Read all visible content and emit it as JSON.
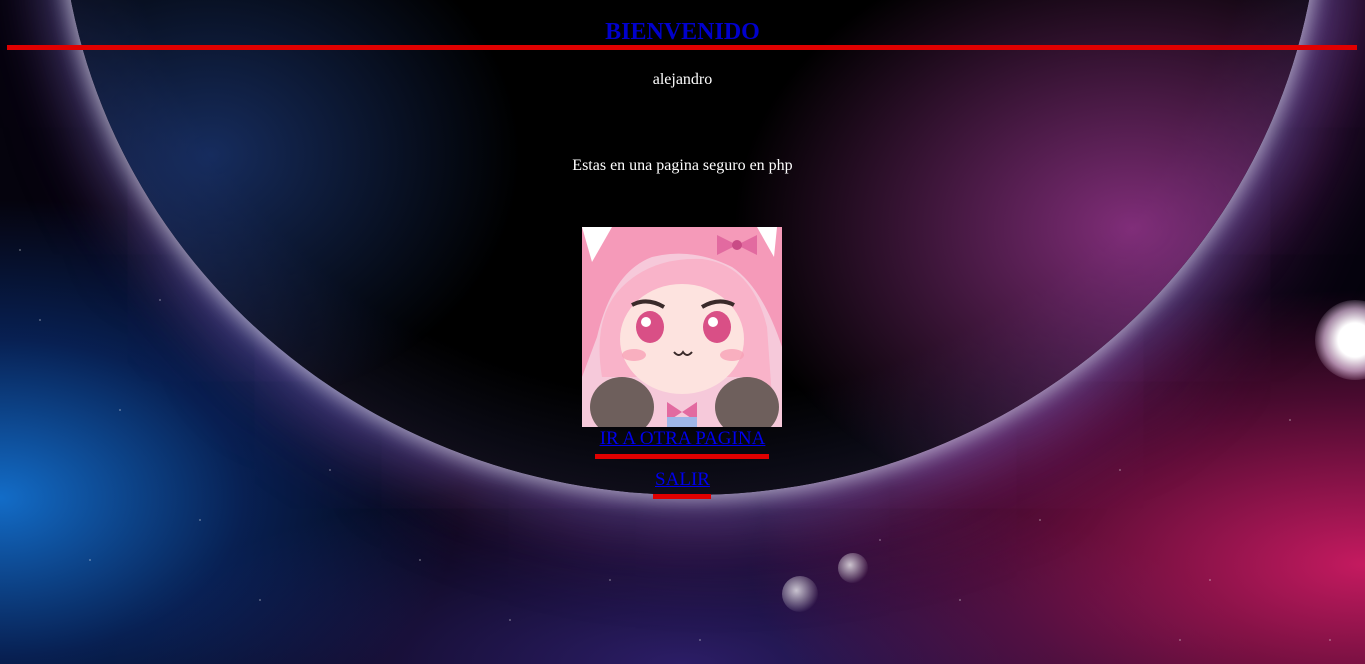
{
  "header": {
    "title": "BIENVENIDO"
  },
  "user": {
    "name": "alejandro"
  },
  "main": {
    "message": "Estas en una pagina seguro en php"
  },
  "links": {
    "other_page": "IR A OTRA PAGINA",
    "logout": "SALIR"
  },
  "colors": {
    "title": "#0000cc",
    "link": "#0000ee",
    "accent_rule": "#e00000",
    "text": "#ffffff"
  }
}
